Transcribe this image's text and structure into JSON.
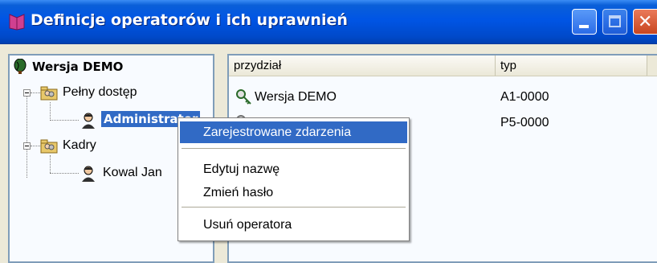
{
  "window": {
    "title": "Definicje operatorów i ich uprawnień",
    "minimize_icon": "minimize-icon",
    "maximize_icon": "maximize-icon",
    "close_icon": "close-icon"
  },
  "tree": {
    "root": {
      "label": "Wersja DEMO",
      "icon": "balloon-icon"
    },
    "groups": [
      {
        "label": "Pełny dostęp",
        "icon": "group-folder-icon",
        "expanded": true,
        "children": [
          {
            "label": "Administrator",
            "icon": "user-icon",
            "selected": true
          }
        ]
      },
      {
        "label": "Kadry",
        "icon": "group-folder-icon",
        "expanded": true,
        "children": [
          {
            "label": "Kowal Jan",
            "icon": "user-icon",
            "selected": false
          }
        ]
      }
    ]
  },
  "list": {
    "columns": [
      "przydział",
      "typ"
    ],
    "rows": [
      {
        "assignment": "Wersja DEMO",
        "type": "A1-0000",
        "icon": "key-icon"
      },
      {
        "assignment": "",
        "type": "P5-0000",
        "icon": "key-icon"
      }
    ]
  },
  "context_menu": {
    "items": [
      {
        "label": "Zarejestrowane zdarzenia",
        "highlighted": true
      },
      {
        "label": "Edytuj nazwę",
        "highlighted": false
      },
      {
        "label": "Zmień hasło",
        "highlighted": false
      },
      {
        "label": "Usuń operatora",
        "highlighted": false
      }
    ]
  },
  "colors": {
    "titlebar": "#0055e5",
    "selection": "#316ac5",
    "panel_background": "#f8fbff"
  }
}
